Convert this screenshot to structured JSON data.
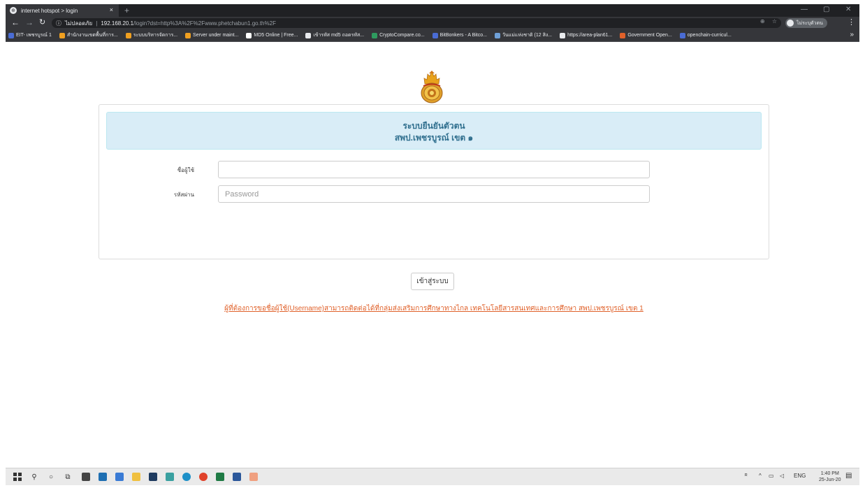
{
  "browser": {
    "tab_title": "internet hotspot > login",
    "tab_close": "×",
    "new_tab": "+",
    "not_secure_label": "ไม่ปลอดภัย",
    "url_host": "192.168.20.1",
    "url_rest": "/login?dst=http%3A%2F%2Fwww.phetchabun1.go.th%2F",
    "profile_label": "ไม่ระบุตัวตน",
    "bookmarks": [
      {
        "label": "EIT- เพชรบูรณ์ 1",
        "color": "#4a6cd4"
      },
      {
        "label": "สำนักงานเขตพื้นที่การ...",
        "color": "#f0a020"
      },
      {
        "label": "ระบบบริหารจัดการ...",
        "color": "#f0a020"
      },
      {
        "label": "Server under maint...",
        "color": "#f0a020"
      },
      {
        "label": "MD5 Online | Free...",
        "color": "#ffffff"
      },
      {
        "label": "เข้ารหัส md5 ถอดรหัส...",
        "color": "#e8eaed"
      },
      {
        "label": "CryptoCompare.co...",
        "color": "#2e9b5f"
      },
      {
        "label": "BitBonkers - A Bitco...",
        "color": "#4a6cd4"
      },
      {
        "label": "วันแม่แห่งชาติ (12 สิง...",
        "color": "#6fa0d8"
      },
      {
        "label": "https://area-plan61...",
        "color": "#e8eaed"
      },
      {
        "label": "Government Open...",
        "color": "#e0612a"
      },
      {
        "label": "openchain-curricul...",
        "color": "#4a6cd4"
      }
    ]
  },
  "page": {
    "header_line1": "ระบบยืนยันตัวตน",
    "header_line2": "สพป.เพชรบูรณ์ เขต ๑",
    "username_label": "ชื่อผู้ใช้",
    "password_label": "รหัสผ่าน",
    "username_value": "",
    "password_placeholder": "Password",
    "login_button": "เข้าสู่ระบบ",
    "contact_note": "ผู้ที่ต้องการขอชื่อผู้ใช้(Username)สามารถติดต่อได้ที่กลุ่มส่งเสริมการศึกษาทางไกล เทคโนโลยีสารสนเทศและการศึกษา สพป.เพชรบูรณ์ เขต 1"
  },
  "taskbar": {
    "lang": "ENG",
    "time": "1:40 PM",
    "date": "25-Jun-20"
  },
  "colors": {
    "header_bg": "#d9edf7",
    "header_text": "#31708f",
    "link": "#e0612a"
  }
}
